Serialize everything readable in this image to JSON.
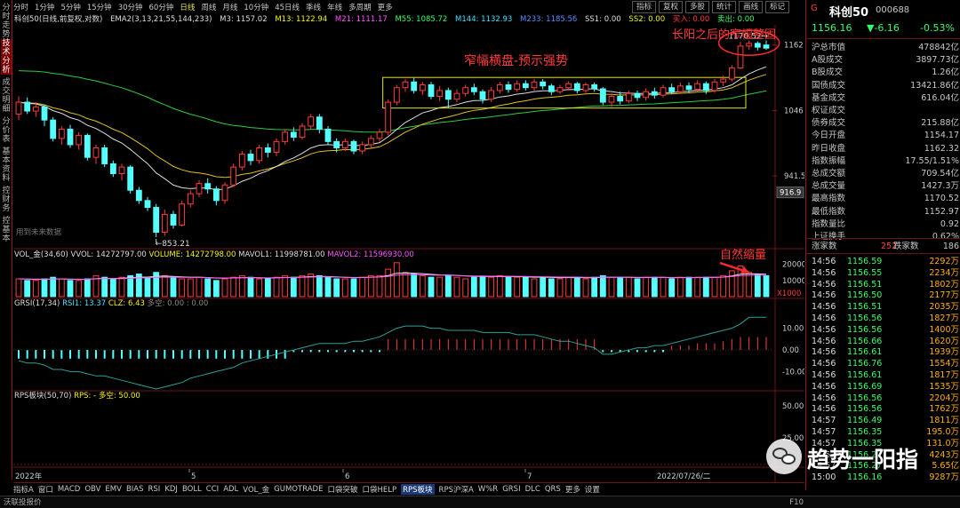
{
  "vertical_tabs": [
    "分时走势",
    "技术分析",
    "成交明细",
    "分价表",
    "基本资料",
    "控财务",
    "控基本"
  ],
  "vertical_active": 1,
  "top_tabs": [
    "分时",
    "1分钟",
    "5分钟",
    "15分钟",
    "30分钟",
    "60分钟",
    "日线",
    "周线",
    "月线",
    "10分钟",
    "45日线",
    "季线",
    "年线",
    "多周期",
    "更多"
  ],
  "top_active": 6,
  "toolbar": [
    "指标",
    "复权",
    "多股",
    "统计",
    "画线",
    "标记"
  ],
  "ind_line": {
    "title": "科创50(日线,前复权,对数)",
    "ema": "EMA2(3,13,21,55,144,233)",
    "m3": "M3: 1157.02",
    "m13": "M13: 1122.94",
    "m21": "M21: 1111.17",
    "m55": "M55: 1085.72",
    "m144": "M144: 1132.93",
    "m233": "M233: 1185.56",
    "ss1": "SS1: 0.00",
    "ss2": "SS2: 0.00",
    "buy": "买入: 0.00",
    "sell": "卖出: 0.00"
  },
  "price_axis": [
    "1162",
    "1046",
    "941.5",
    "916.9"
  ],
  "price_annot": {
    "low": "853.21",
    "high": "1170.52"
  },
  "future_label": "用到未来数据",
  "annotations": {
    "consolidation": "窄幅横盘-预示强势",
    "after": "长阳之后的窄幅整固",
    "shrink": "自然缩量"
  },
  "vol_line": {
    "name": "VOL_金(34,60)",
    "vvol": "VVOL: 14272797.00",
    "volume": "VOLUME: 14272798.00",
    "mavol1": "MAVOL1: 11998781.00",
    "mavol2": "MAVOL2: 11596930.00"
  },
  "vol_axis": [
    "20000",
    "10000",
    "X1000"
  ],
  "grsi_line": {
    "name": "GRSI(17,34)",
    "rsi1": "RSI1: 13.37",
    "clz": "CLZ: 6.43",
    "dk": "多空: 0.00 : 0.00"
  },
  "grsi_axis": [
    "10.00",
    "0.00",
    "-10.00"
  ],
  "rps_line": {
    "name": "RPS板块(50,70)",
    "rps": "RPS: - 多空: 50.00"
  },
  "rps_axis": [
    "50.00",
    "25.00"
  ],
  "date_axis": [
    "2022年",
    "5",
    "6",
    "7",
    "2022/07/26/二"
  ],
  "bottom_tabs": [
    "指标A",
    "窗口",
    "MACD",
    "OBV",
    "EMV",
    "BIAS",
    "RSI",
    "KDJ",
    "BOLL",
    "CCI",
    "ADL",
    "VOL_金",
    "GUMOTRADE",
    "口袋突破",
    "口袋HELP",
    "RPS板块",
    "RPS沪深A",
    "W%R",
    "GRSI",
    "DLC",
    "QRS",
    "更多",
    "设置"
  ],
  "bottom_active": 15,
  "status": {
    "left": "沃联投报价",
    "right": "F10"
  },
  "rp_header": {
    "flag": "G",
    "name": "科创50",
    "code": "000688",
    "price": "1156.16",
    "chg": "▼-6.16",
    "pct": "-0.53%"
  },
  "rp_rows": [
    {
      "l": "沪总市值",
      "v": "478842亿",
      "c": "wht"
    },
    {
      "l": "A股成交",
      "v": "3897.73亿",
      "c": "org"
    },
    {
      "l": "B股成交",
      "v": "1.26亿",
      "c": "org"
    },
    {
      "l": "国债成交",
      "v": "13421.86亿",
      "c": "org"
    },
    {
      "l": "基金成交",
      "v": "616.04亿",
      "c": "org"
    },
    {
      "l": "权证成交",
      "v": "",
      "c": "org"
    },
    {
      "l": "债券成交",
      "v": "215.88亿",
      "c": "org"
    },
    {
      "l": "今日开盘",
      "v": "1154.17",
      "c": "green"
    },
    {
      "l": "昨日收盘",
      "v": "1162.32",
      "c": "wht"
    },
    {
      "l": "指数振幅",
      "v": "17.55/1.51%",
      "c": "wht"
    },
    {
      "l": "总成交额",
      "v": "709.54亿",
      "c": "org"
    },
    {
      "l": "总成交量",
      "v": "1427.3万",
      "c": "org"
    },
    {
      "l": "最高指数",
      "v": "1170.52",
      "c": "red"
    },
    {
      "l": "最低指数",
      "v": "1152.97",
      "c": "green"
    },
    {
      "l": "指数量比",
      "v": "0.92",
      "c": "wht"
    },
    {
      "l": "上证换手",
      "v": "0.62%",
      "c": "wht"
    }
  ],
  "rp_updown": {
    "up_l": "涨家数",
    "up_v": "252",
    "dn_l": "跌家数",
    "dn_v": "186"
  },
  "ticks": [
    [
      "14:56",
      "1156.59",
      "2292万"
    ],
    [
      "14:56",
      "1156.55",
      "2234万"
    ],
    [
      "14:56",
      "1156.51",
      "1802万"
    ],
    [
      "14:56",
      "1156.50",
      "2177万"
    ],
    [
      "14:56",
      "1156.51",
      "2035万"
    ],
    [
      "14:56",
      "1156.56",
      "1827万"
    ],
    [
      "14:56",
      "1156.56",
      "1400万"
    ],
    [
      "14:56",
      "1156.66",
      "1620万"
    ],
    [
      "14:56",
      "1156.61",
      "1939万"
    ],
    [
      "14:56",
      "1156.76",
      "1554万"
    ],
    [
      "14:56",
      "1156.61",
      "1817万"
    ],
    [
      "14:56",
      "1156.69",
      "1535万"
    ],
    [
      "14:56",
      "1156.56",
      "2204万"
    ],
    [
      "14:56",
      "1156.56",
      "1762万"
    ],
    [
      "14:57",
      "1156.49",
      "1811万"
    ],
    [
      "14:57",
      "1156.35",
      "195.0万"
    ],
    [
      "14:57",
      "1156.35",
      "131.0万"
    ],
    [
      "14:57",
      "1156.27",
      "4243万"
    ],
    [
      "14:57",
      "1156.27",
      "5.65亿"
    ],
    [
      "15:00",
      "1156.16",
      "9287万"
    ]
  ],
  "watermark": "趋势一阳指",
  "chart_data": {
    "type": "candlestick",
    "candles": [
      [
        1040,
        1060,
        1070,
        1030
      ],
      [
        1060,
        1045,
        1068,
        1040
      ],
      [
        1045,
        1052,
        1060,
        1035
      ],
      [
        1052,
        1030,
        1055,
        1020
      ],
      [
        1030,
        1000,
        1035,
        995
      ],
      [
        1000,
        1015,
        1020,
        990
      ],
      [
        1015,
        990,
        1022,
        985
      ],
      [
        990,
        1005,
        1010,
        982
      ],
      [
        1005,
        970,
        1008,
        965
      ],
      [
        970,
        985,
        990,
        960
      ],
      [
        985,
        960,
        990,
        955
      ],
      [
        960,
        945,
        965,
        940
      ],
      [
        945,
        955,
        960,
        935
      ],
      [
        955,
        920,
        958,
        915
      ],
      [
        920,
        905,
        925,
        900
      ],
      [
        905,
        895,
        910,
        890
      ],
      [
        895,
        860,
        900,
        853.21
      ],
      [
        860,
        885,
        892,
        855
      ],
      [
        885,
        870,
        890,
        865
      ],
      [
        870,
        900,
        905,
        868
      ],
      [
        900,
        915,
        920,
        895
      ],
      [
        915,
        930,
        935,
        910
      ],
      [
        930,
        922,
        938,
        915
      ],
      [
        922,
        905,
        926,
        898
      ],
      [
        905,
        928,
        932,
        900
      ],
      [
        928,
        955,
        960,
        925
      ],
      [
        955,
        975,
        980,
        950
      ],
      [
        975,
        965,
        982,
        958
      ],
      [
        965,
        985,
        990,
        960
      ],
      [
        985,
        978,
        992,
        970
      ],
      [
        978,
        995,
        1000,
        972
      ],
      [
        995,
        1010,
        1015,
        990
      ],
      [
        1010,
        1002,
        1018,
        996
      ],
      [
        1002,
        1020,
        1025,
        998
      ],
      [
        1020,
        1035,
        1040,
        1015
      ],
      [
        1035,
        1015,
        1040,
        1008
      ],
      [
        1015,
        995,
        1020,
        990
      ],
      [
        995,
        985,
        1000,
        978
      ],
      [
        985,
        995,
        1000,
        980
      ],
      [
        995,
        980,
        998,
        975
      ],
      [
        980,
        990,
        995,
        975
      ],
      [
        990,
        1000,
        1005,
        985
      ],
      [
        1000,
        1010,
        1015,
        995
      ],
      [
        1010,
        1060,
        1065,
        1005
      ],
      [
        1060,
        1085,
        1090,
        1055
      ],
      [
        1085,
        1095,
        1100,
        1078
      ],
      [
        1095,
        1080,
        1102,
        1075
      ],
      [
        1080,
        1090,
        1095,
        1072
      ],
      [
        1090,
        1070,
        1095,
        1065
      ],
      [
        1070,
        1080,
        1088,
        1062
      ],
      [
        1080,
        1065,
        1085,
        1050
      ],
      [
        1065,
        1075,
        1082,
        1060
      ],
      [
        1075,
        1085,
        1090,
        1070
      ],
      [
        1085,
        1078,
        1092,
        1072
      ],
      [
        1078,
        1065,
        1082,
        1058
      ],
      [
        1065,
        1080,
        1086,
        1060
      ],
      [
        1080,
        1090,
        1095,
        1075
      ],
      [
        1090,
        1082,
        1096,
        1076
      ],
      [
        1082,
        1092,
        1098,
        1078
      ],
      [
        1092,
        1085,
        1098,
        1080
      ],
      [
        1085,
        1095,
        1100,
        1080
      ],
      [
        1095,
        1088,
        1100,
        1082
      ],
      [
        1088,
        1078,
        1092,
        1072
      ],
      [
        1078,
        1085,
        1090,
        1074
      ],
      [
        1085,
        1092,
        1096,
        1080
      ],
      [
        1092,
        1080,
        1095,
        1075
      ],
      [
        1080,
        1090,
        1094,
        1076
      ],
      [
        1090,
        1083,
        1094,
        1078
      ],
      [
        1083,
        1060,
        1086,
        1055
      ],
      [
        1060,
        1070,
        1075,
        1052
      ],
      [
        1070,
        1062,
        1078,
        1056
      ],
      [
        1062,
        1075,
        1080,
        1058
      ],
      [
        1075,
        1068,
        1080,
        1062
      ],
      [
        1068,
        1078,
        1084,
        1063
      ],
      [
        1078,
        1072,
        1085,
        1066
      ],
      [
        1072,
        1085,
        1090,
        1068
      ],
      [
        1085,
        1078,
        1092,
        1074
      ],
      [
        1078,
        1088,
        1094,
        1074
      ],
      [
        1088,
        1082,
        1094,
        1076
      ],
      [
        1082,
        1092,
        1098,
        1078
      ],
      [
        1092,
        1080,
        1096,
        1074
      ],
      [
        1080,
        1095,
        1100,
        1076
      ],
      [
        1095,
        1100,
        1106,
        1088
      ],
      [
        1100,
        1120,
        1125,
        1096
      ],
      [
        1120,
        1160,
        1168,
        1118
      ],
      [
        1160,
        1165,
        1170.52,
        1152.97
      ],
      [
        1165,
        1158,
        1169,
        1152
      ],
      [
        1162,
        1156.16,
        1170.52,
        1152.97
      ]
    ],
    "volume": [
      11,
      10,
      10,
      11,
      12,
      11,
      10,
      10,
      11,
      13,
      12,
      11,
      12,
      13,
      14,
      12,
      15,
      13,
      12,
      11,
      11,
      12,
      11,
      10,
      11,
      12,
      13,
      12,
      11,
      11,
      12,
      13,
      12,
      13,
      14,
      13,
      12,
      11,
      11,
      11,
      12,
      13,
      13,
      17,
      21,
      15,
      14,
      13,
      12,
      12,
      13,
      12,
      11,
      12,
      12,
      12,
      13,
      12,
      12,
      12,
      11,
      12,
      11,
      11,
      12,
      12,
      11,
      12,
      13,
      12,
      12,
      12,
      11,
      12,
      12,
      12,
      11,
      12,
      12,
      12,
      12,
      12,
      13,
      16,
      19,
      15,
      14,
      13
    ],
    "vol_ylim": [
      0,
      22000
    ],
    "rsi1": [
      -5,
      -6,
      -6,
      -7,
      -9,
      -9,
      -10,
      -10,
      -11,
      -12,
      -12,
      -13,
      -14,
      -15,
      -16,
      -17,
      -18,
      -17,
      -16,
      -15,
      -13,
      -12,
      -11,
      -10,
      -9,
      -8,
      -6,
      -5,
      -4,
      -3,
      -2,
      -1,
      0,
      1,
      2,
      3,
      3,
      3,
      3,
      4,
      4,
      5,
      6,
      8,
      10,
      11,
      11,
      11,
      10,
      10,
      9,
      9,
      9,
      9,
      8,
      8,
      8,
      8,
      7,
      7,
      7,
      6,
      5,
      4,
      4,
      3,
      2,
      1,
      -2,
      -2,
      -1,
      0,
      1,
      1,
      2,
      2,
      3,
      4,
      5,
      6,
      7,
      8,
      9,
      10,
      12,
      15,
      15,
      15
    ],
    "clz": [
      -4,
      -4,
      -4,
      -4,
      -4,
      -4,
      -4,
      -4,
      -4,
      -4,
      -4,
      -4,
      -4,
      -4,
      -4,
      -4,
      -4,
      -4,
      -4,
      -4,
      -4,
      -4,
      -4,
      -4,
      -4,
      -4,
      -4,
      -4,
      -4,
      -4,
      -4,
      -4,
      -1,
      -1,
      -1,
      -1,
      -1,
      -1,
      -1,
      -1,
      -1,
      -1,
      -1,
      5,
      5,
      5,
      5,
      5,
      5,
      5,
      5,
      5,
      5,
      5,
      5,
      5,
      5,
      5,
      5,
      5,
      5,
      5,
      5,
      5,
      5,
      5,
      5,
      5,
      -1,
      -1,
      -1,
      -1,
      -1,
      -1,
      -1,
      -1,
      2,
      2,
      2,
      3,
      3,
      3,
      4,
      5,
      6,
      6,
      6,
      6
    ],
    "grsi_ylim": [
      -18,
      18
    ]
  }
}
